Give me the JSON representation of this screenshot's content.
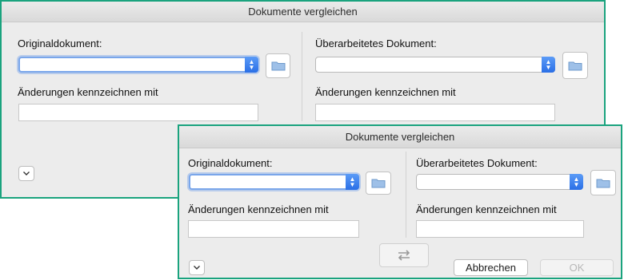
{
  "back_dialog": {
    "title": "Dokumente vergleichen",
    "original": {
      "label": "Originaldokument:",
      "value": "",
      "changes_label": "Änderungen kennzeichnen mit",
      "changes_value": ""
    },
    "revised": {
      "label": "Überarbeitetes Dokument:",
      "value": "",
      "changes_label": "Änderungen kennzeichnen mit",
      "changes_value": ""
    }
  },
  "front_dialog": {
    "title": "Dokumente vergleichen",
    "original": {
      "label": "Originaldokument:",
      "value": "",
      "changes_label": "Änderungen kennzeichnen mit",
      "changes_value": ""
    },
    "revised": {
      "label": "Überarbeitetes Dokument:",
      "value": "",
      "changes_label": "Änderungen kennzeichnen mit",
      "changes_value": ""
    },
    "cancel_label": "Abbrechen",
    "ok_label": "OK"
  },
  "icons": {
    "folder": "folder-icon",
    "chevron": "chevron-down-icon",
    "swap": "swap-arrows-icon",
    "stepper": "up-down-arrows-icon"
  },
  "colors": {
    "frame": "#1aa37e",
    "focus": "#7aa6ea",
    "stepper": "#2a6fe6",
    "folder": "#7ea7d9"
  }
}
